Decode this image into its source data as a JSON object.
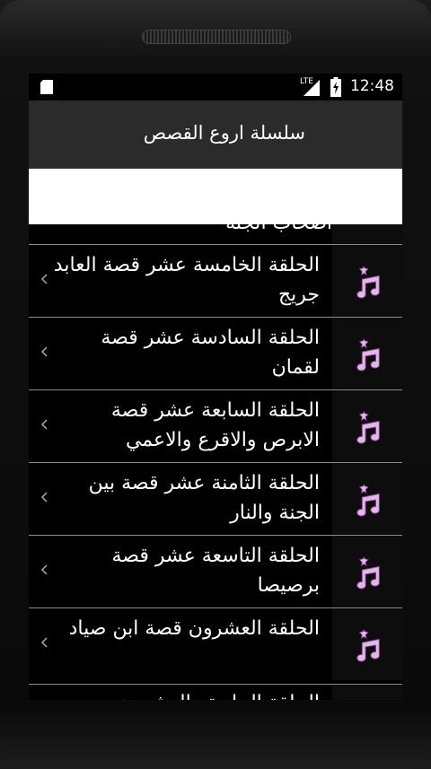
{
  "status": {
    "network": "LTE",
    "time": "12:48"
  },
  "app": {
    "title": "سلسلة اروع القصص"
  },
  "list": {
    "partial_top_label": "اصحاب الجنة",
    "items": [
      {
        "label": "الحلقة الخامسة عشر قصة العابد جريج"
      },
      {
        "label": "الحلقة السادسة عشر قصة لقمان"
      },
      {
        "label": "الحلقة السابعة عشر قصة الابرص والاقرع والاعمي"
      },
      {
        "label": "الحلقة الثامنة عشر قصة بين الجنة والنار"
      },
      {
        "label": "الحلقة التاسعة عشر قصة برصيصا"
      },
      {
        "label": "الحلقة العشرون قصة ابن صياد"
      }
    ],
    "partial_bottom_label": "الحلقة الحادية والعشرون"
  },
  "icons": {
    "list_item": "music-note-icon",
    "chevron": "chevron-left-icon"
  },
  "colors": {
    "action_bar": "#2b2b2b",
    "icon_fill": "#e8b4f0",
    "divider": "#8a8a8a"
  }
}
